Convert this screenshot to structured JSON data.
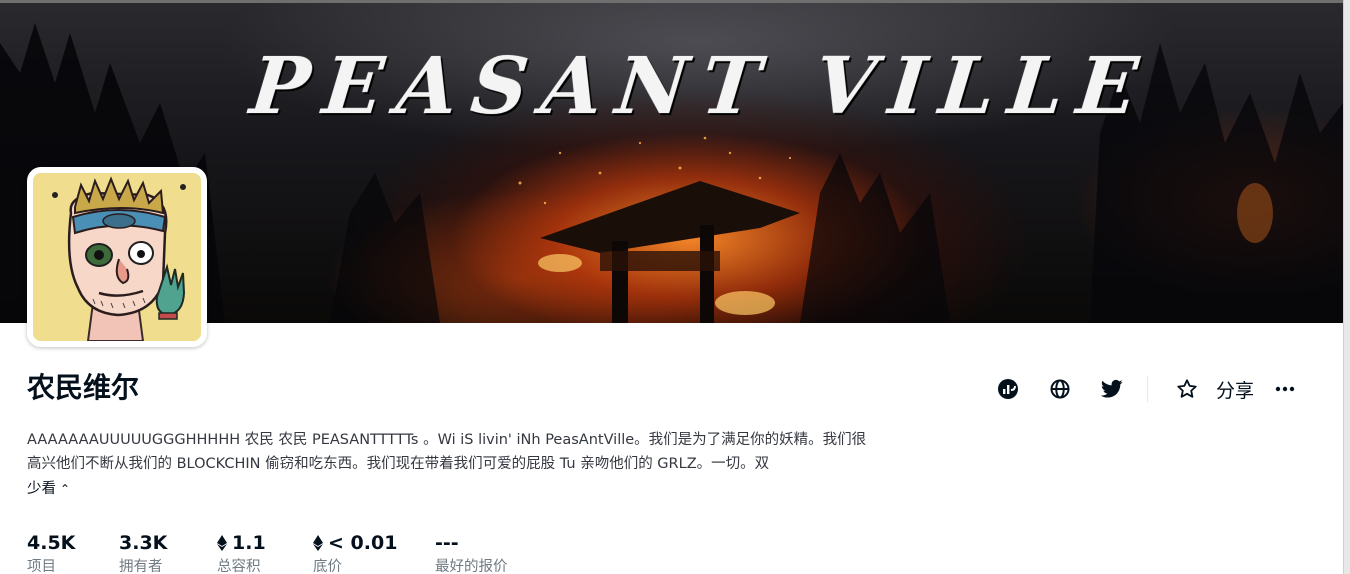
{
  "banner": {
    "title": "PEASANT VILLE"
  },
  "collection": {
    "title": "农民维尔",
    "description_line1": "AAAAAAAUUUUUGGGHHHHH 农民 农民 PEASANTTTTTs 。Wi iS livin' iNh PeasAntVille。我们是为了满足你的妖精。我们很",
    "description_line2": "高兴他们不断从我们的 BLOCKCHIN 偷窃和吃东西。我们现在带着我们可爱的屁股 Tu 亲吻他们的 GRLZ。一切。双",
    "see_more": "少看"
  },
  "actions": {
    "items": [
      {
        "name": "activity-icon"
      },
      {
        "name": "globe-icon"
      },
      {
        "name": "twitter-icon"
      },
      {
        "name": "star-icon"
      }
    ],
    "share_label": "分享",
    "more_icon": "ellipsis-icon"
  },
  "stats": [
    {
      "value": "4.5K",
      "label": "项目",
      "eth": false
    },
    {
      "value": "3.3K",
      "label": "拥有者",
      "eth": false
    },
    {
      "value": "1.1",
      "label": "总容积",
      "eth": true
    },
    {
      "value": "< 0.01",
      "label": "底价",
      "eth": true
    },
    {
      "value": "---",
      "label": "最好的报价",
      "eth": false
    }
  ],
  "colors": {
    "text_primary": "#04111d",
    "text_secondary": "#707a83",
    "avatar_background": "#f0dd8e"
  }
}
